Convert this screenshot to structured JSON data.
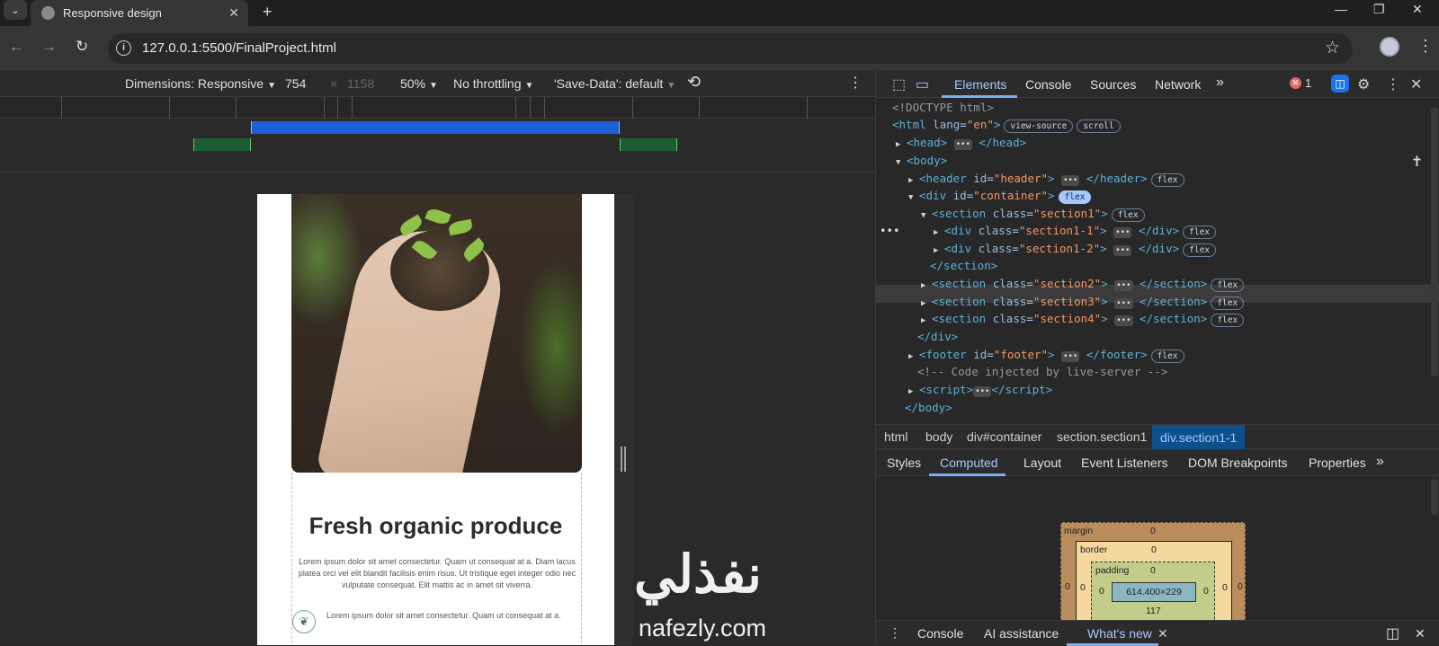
{
  "browser": {
    "tab_title": "Responsive design",
    "url": "127.0.0.1:5500/FinalProject.html",
    "new_tab": "+",
    "tab_close": "✕"
  },
  "device_toolbar": {
    "dimensions_label": "Dimensions: Responsive",
    "width": "754",
    "times": "×",
    "height": "1158",
    "zoom": "50%",
    "throttling": "No throttling",
    "save_data": "'Save-Data': default"
  },
  "page": {
    "headline": "Fresh organic produce",
    "paragraph": "Lorem ipsum dolor sit amet consectetur. Quam ut consequat at a. Diam lacus platea orci vel elit blandit facilisis enim risus. Ut tristique eget integer odio nec vulputate consequat. Elit mattis ac in amet sit viverra.",
    "feature_text": "Lorem ipsum dolor sit amet consectetur. Quam ut consequat at a."
  },
  "watermark": {
    "arabic": "نفذلي",
    "latin": "nafezly.com"
  },
  "devtools": {
    "tabs": [
      "Elements",
      "Console",
      "Sources",
      "Network"
    ],
    "more": "»",
    "error_count": "1",
    "dom": {
      "doctype": "<!DOCTYPE html>",
      "view_source": "view-source",
      "scroll": "scroll",
      "comment": "<!-- Code injected by live-server -->",
      "flex": "flex"
    },
    "breadcrumbs": [
      "html",
      "body",
      "div#container",
      "section.section1",
      "div.section1-1"
    ],
    "subtabs": [
      "Styles",
      "Computed",
      "Layout",
      "Event Listeners",
      "DOM Breakpoints",
      "Properties"
    ],
    "box_model": {
      "margin_label": "margin",
      "border_label": "border",
      "padding_label": "padding",
      "content": "614.400×229",
      "zero": "0",
      "bottom_value": "117"
    },
    "drawer": [
      "Console",
      "AI assistance",
      "What's new"
    ]
  }
}
